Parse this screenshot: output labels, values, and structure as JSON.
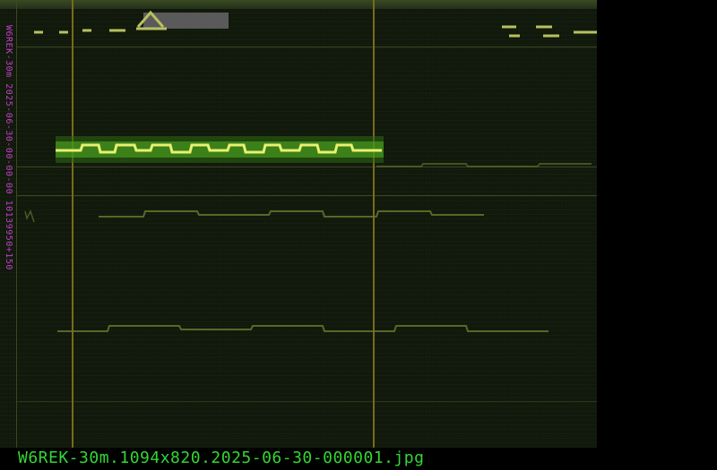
{
  "image": {
    "filename": "W6REK-30m.1094x820.2025-06-30-000001.jpg",
    "side_label": "W6REK-30m 2025-06-30-00-00-00 10139950+150"
  },
  "colors": {
    "background": "#000000",
    "waterfall_noise": "#0d120a",
    "signal_bright": "#e8f070",
    "signal_glow": "#4ea820",
    "cursor_line": "#7a6a1a",
    "side_label": "#c040c8",
    "filename_text": "#33d633"
  }
}
